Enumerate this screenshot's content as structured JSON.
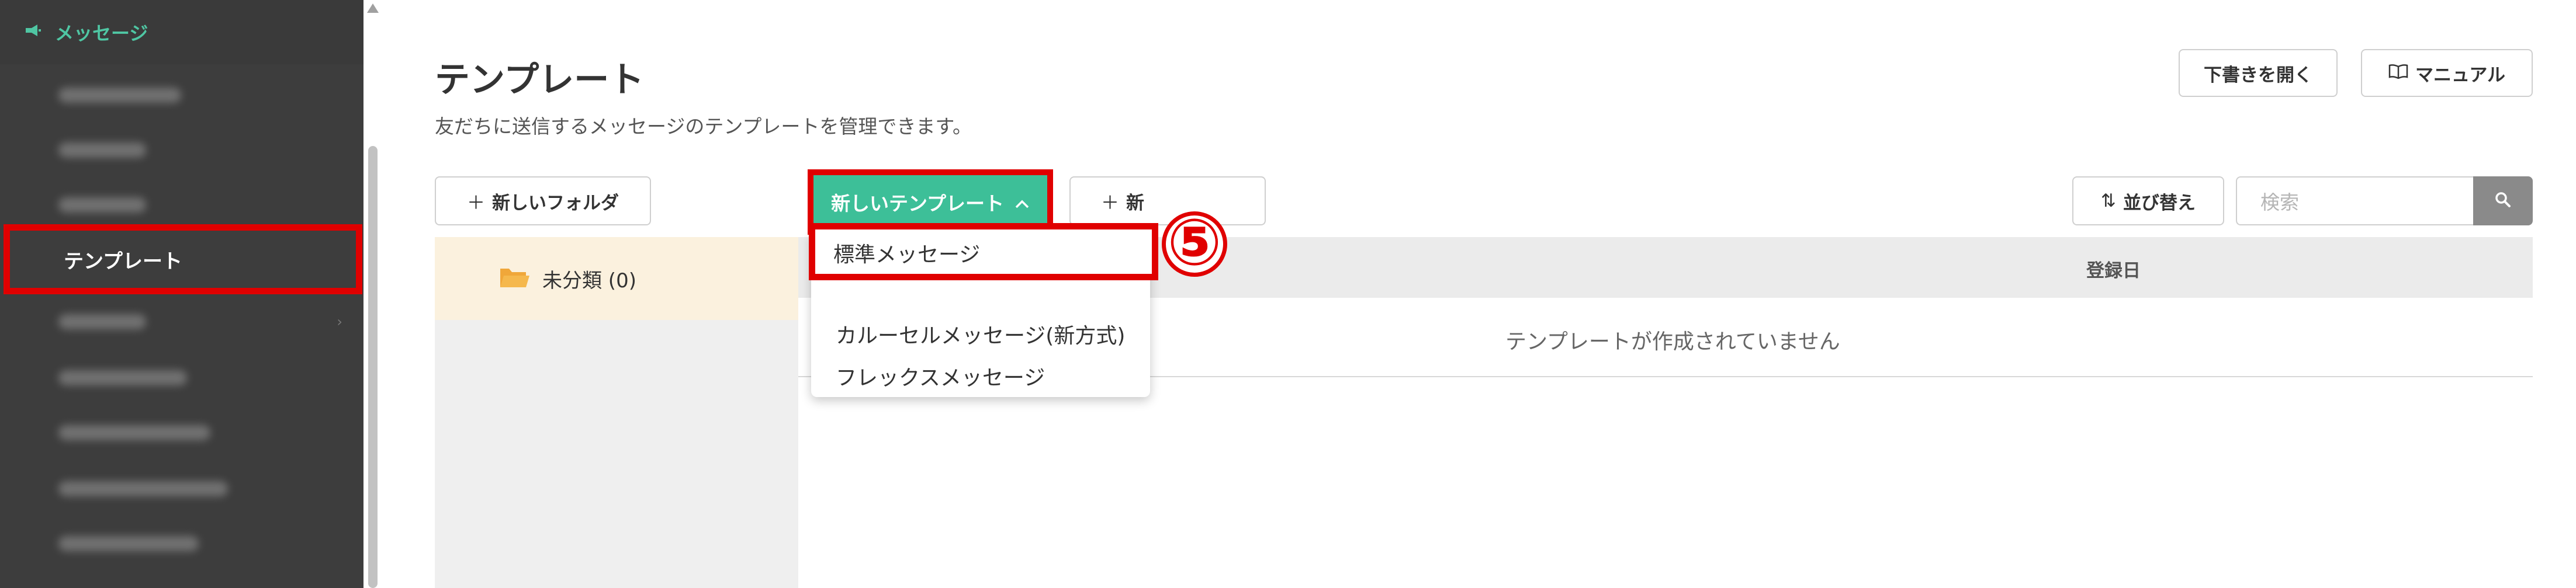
{
  "sidebar": {
    "section_label": "メッセージ",
    "active_item": "テンプレート"
  },
  "page": {
    "title": "テンプレート",
    "subtitle": "友だちに送信するメッセージのテンプレートを管理できます。"
  },
  "header_buttons": {
    "drafts": "下書きを開く",
    "manual": "マニュアル"
  },
  "toolbar": {
    "new_folder": "新しいフォルダ",
    "new_template": "新しいテンプレート",
    "second_button": "新",
    "sort": "並び替え",
    "search_placeholder": "検索"
  },
  "folders": [
    {
      "name": "未分類 (0)"
    }
  ],
  "table": {
    "column_date": "登録日",
    "empty_message": "テンプレートが作成されていません"
  },
  "dropdown": {
    "items": [
      "標準メッセージ",
      "カルーセルメッセージ(新方式)",
      "フレックスメッセージ"
    ]
  },
  "annotation": {
    "step_marker": "⑤"
  },
  "colors": {
    "accent_green": "#3dbf98",
    "highlight_red": "#e00000",
    "sidebar_bg": "#3d3d3d"
  }
}
